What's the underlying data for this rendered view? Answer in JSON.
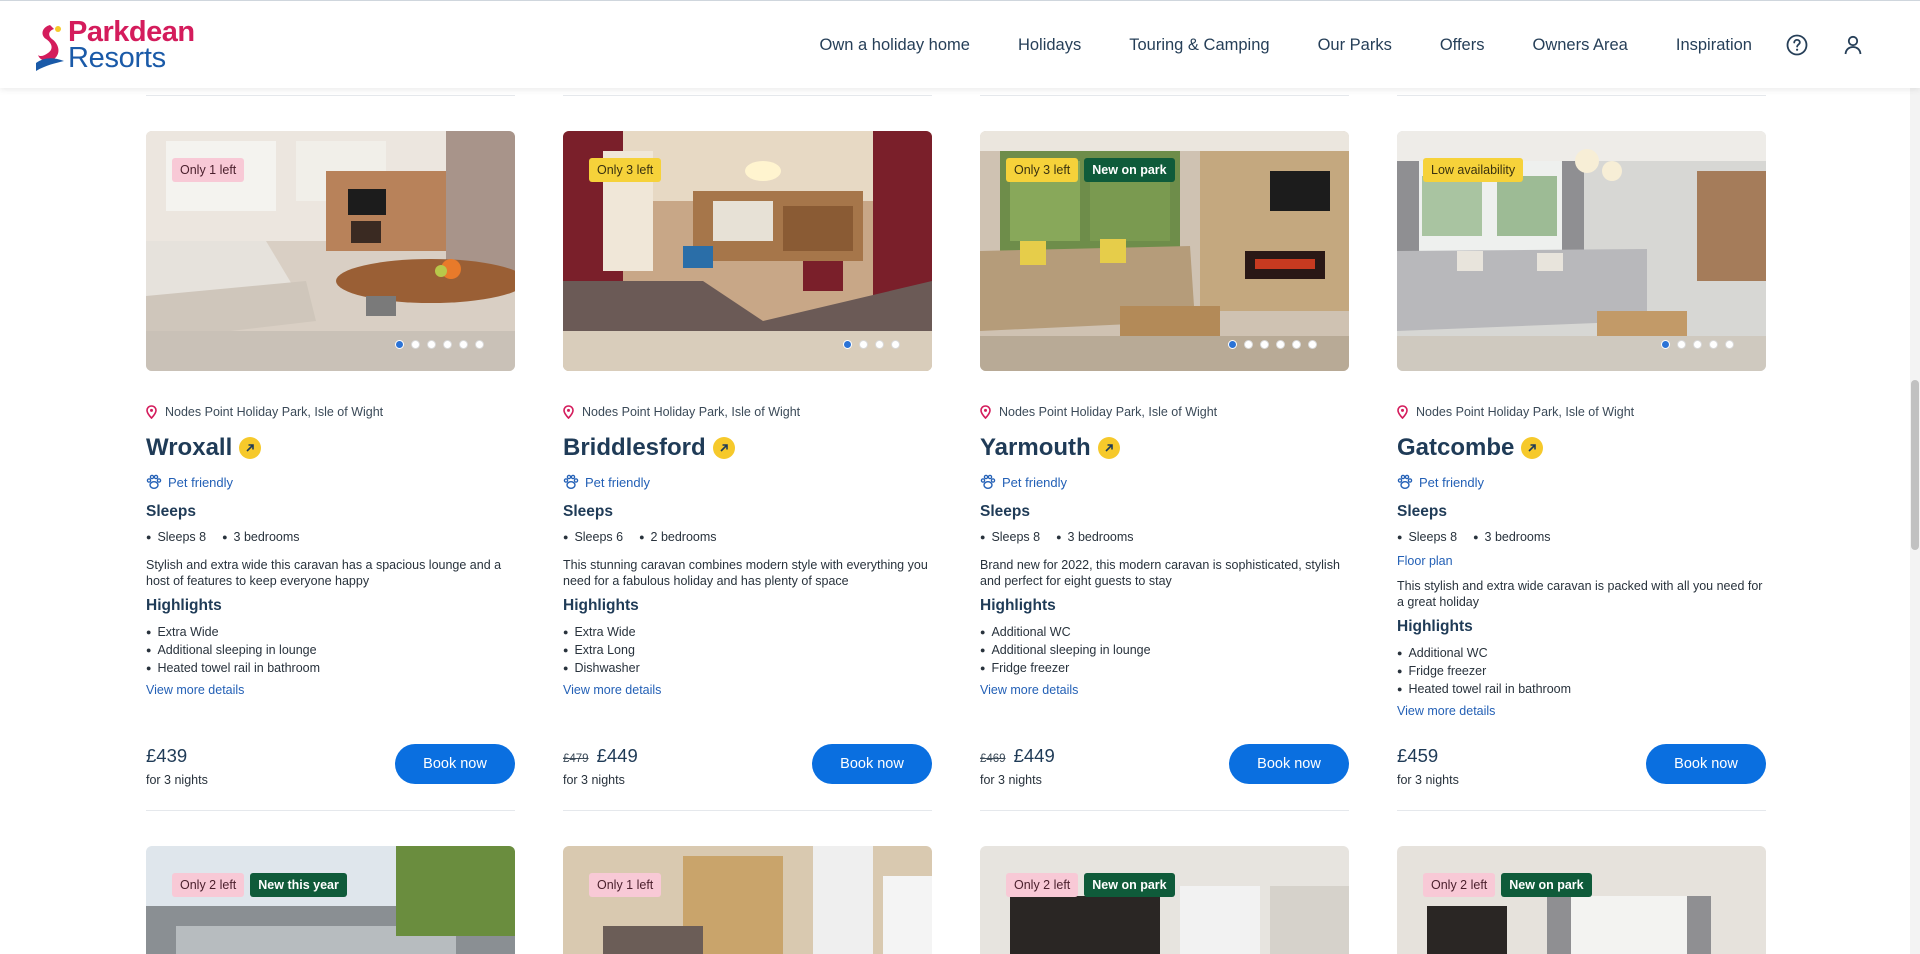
{
  "brand": {
    "line1": "Parkdean",
    "line2": "Resorts",
    "colors": {
      "primary": "#d41c5c",
      "secondary": "#1a5aa8"
    }
  },
  "nav": {
    "items": [
      "Own a holiday home",
      "Holidays",
      "Touring & Camping",
      "Our Parks",
      "Offers",
      "Owners Area",
      "Inspiration"
    ],
    "help_icon": "help-circle-icon",
    "account_icon": "user-icon"
  },
  "labels": {
    "sleeps": "Sleeps",
    "highlights": "Highlights",
    "view_more": "View more details",
    "book": "Book now",
    "pet": "Pet friendly",
    "floor_plan": "Floor plan"
  },
  "cards": [
    {
      "badges": [
        {
          "text": "Only 1 left",
          "style": "pink"
        }
      ],
      "dots": 6,
      "location": "Nodes Point Holiday Park, Isle of Wight",
      "name": "Wroxall",
      "specs": [
        "Sleeps 8",
        "3 bedrooms"
      ],
      "description": "Stylish and extra wide this caravan has a spacious lounge and a host of features to keep everyone happy",
      "highlights": [
        "Extra Wide",
        "Additional sleeping in lounge",
        "Heated towel rail in bathroom"
      ],
      "was_price": "",
      "price": "£439",
      "nights": "for 3 nights"
    },
    {
      "badges": [
        {
          "text": "Only 3 left",
          "style": "yellow"
        }
      ],
      "dots": 4,
      "location": "Nodes Point Holiday Park, Isle of Wight",
      "name": "Briddlesford",
      "specs": [
        "Sleeps 6",
        "2 bedrooms"
      ],
      "description": "This stunning caravan combines modern style with everything you need for a fabulous holiday and has plenty of space",
      "highlights": [
        "Extra Wide",
        "Extra Long",
        "Dishwasher"
      ],
      "was_price": "£479",
      "price": "£449",
      "nights": "for 3 nights"
    },
    {
      "badges": [
        {
          "text": "Only 3 left",
          "style": "yellow"
        },
        {
          "text": "New on park",
          "style": "green"
        }
      ],
      "dots": 6,
      "location": "Nodes Point Holiday Park, Isle of Wight",
      "name": "Yarmouth",
      "specs": [
        "Sleeps 8",
        "3 bedrooms"
      ],
      "description": "Brand new for 2022, this modern caravan is sophisticated, stylish and perfect for eight guests to stay",
      "highlights": [
        "Additional WC",
        "Additional sleeping in lounge",
        "Fridge freezer"
      ],
      "was_price": "£469",
      "price": "£449",
      "nights": "for 3 nights"
    },
    {
      "badges": [
        {
          "text": "Low availability",
          "style": "yellow"
        }
      ],
      "dots": 5,
      "location": "Nodes Point Holiday Park, Isle of Wight",
      "name": "Gatcombe",
      "specs": [
        "Sleeps 8",
        "3 bedrooms"
      ],
      "floor_plan": true,
      "description": "This stylish and extra wide caravan is packed with all you need for a great holiday",
      "highlights": [
        "Additional WC",
        "Fridge freezer",
        "Heated towel rail in bathroom"
      ],
      "was_price": "",
      "price": "£459",
      "nights": "for 3 nights"
    }
  ],
  "row2": [
    {
      "badges": [
        {
          "text": "Only 2 left",
          "style": "pink"
        },
        {
          "text": "New this year",
          "style": "green"
        }
      ]
    },
    {
      "badges": [
        {
          "text": "Only 1 left",
          "style": "pink"
        }
      ]
    },
    {
      "badges": [
        {
          "text": "Only 2 left",
          "style": "pink"
        },
        {
          "text": "New on park",
          "style": "green"
        }
      ]
    },
    {
      "badges": [
        {
          "text": "Only 2 left",
          "style": "pink"
        },
        {
          "text": "New on park",
          "style": "green"
        }
      ]
    }
  ]
}
